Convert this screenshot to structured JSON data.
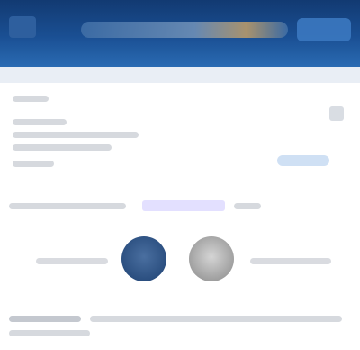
{
  "header": {
    "logo_icon": "logo-icon",
    "title": "",
    "right_control": ""
  },
  "panel": {
    "heading": "",
    "rows": [
      "",
      "",
      "",
      ""
    ],
    "action_link": ""
  },
  "links": {
    "text": "",
    "highlighted": ""
  },
  "people": {
    "left_name": "",
    "right_name": "",
    "avatar_left_icon": "avatar-icon",
    "avatar_right_icon": "avatar-icon"
  },
  "footer": {
    "text": ""
  }
}
